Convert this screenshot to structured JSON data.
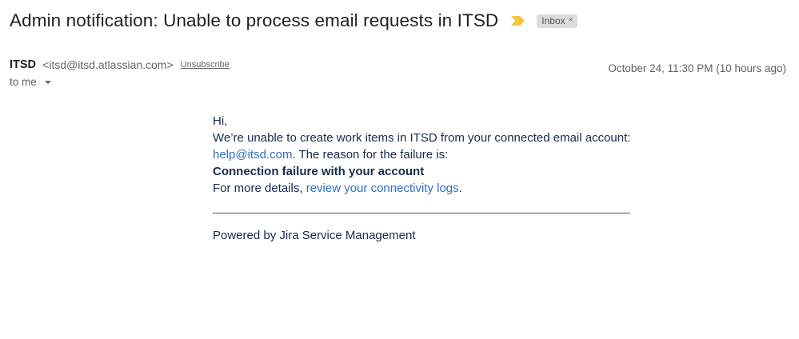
{
  "email": {
    "subject": "Admin notification: Unable to process email requests in ITSD",
    "label": "Inbox",
    "label_close": "×",
    "sender_name": "ITSD",
    "sender_email": "<itsd@itsd.atlassian.com>",
    "unsubscribe": "Unsubscribe",
    "recipient": "to me",
    "date": "October 24, 11:30 PM (10 hours ago)",
    "importance_color": "#f4c542"
  },
  "body": {
    "greeting": "Hi,",
    "intro": "We’re unable to create work items in ITSD from your connected email account:",
    "account_link": "help@itsd.com",
    "reason_text": ". The reason for the failure is:",
    "failure_reason": "Connection failure with your account",
    "details_prefix": "For more details, ",
    "details_link": "review your connectivity logs",
    "details_suffix": ".",
    "footer": "Powered by Jira Service Management"
  }
}
